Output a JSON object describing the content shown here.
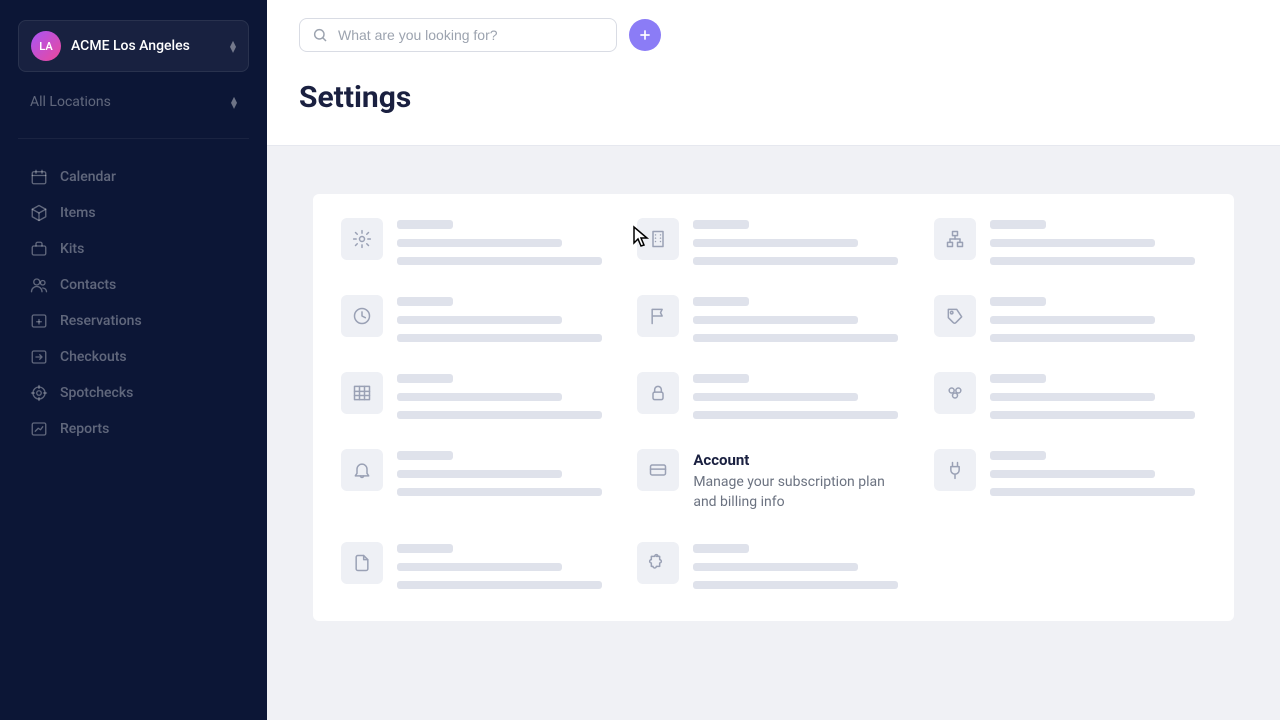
{
  "workspace": {
    "avatar": "LA",
    "name": "ACME Los Angeles"
  },
  "locations": {
    "label": "All Locations"
  },
  "nav": [
    {
      "label": "Calendar",
      "icon": "calendar"
    },
    {
      "label": "Items",
      "icon": "cube"
    },
    {
      "label": "Kits",
      "icon": "briefcase"
    },
    {
      "label": "Contacts",
      "icon": "users"
    },
    {
      "label": "Reservations",
      "icon": "reservation"
    },
    {
      "label": "Checkouts",
      "icon": "checkout"
    },
    {
      "label": "Spotchecks",
      "icon": "target"
    },
    {
      "label": "Reports",
      "icon": "chart"
    }
  ],
  "search": {
    "placeholder": "What are you looking for?"
  },
  "page": {
    "title": "Settings"
  },
  "tiles": [
    {
      "icon": "gear",
      "skeleton": true
    },
    {
      "icon": "building",
      "skeleton": true
    },
    {
      "icon": "sitemap",
      "skeleton": true
    },
    {
      "icon": "clock",
      "skeleton": true
    },
    {
      "icon": "flag",
      "skeleton": true
    },
    {
      "icon": "tag",
      "skeleton": true
    },
    {
      "icon": "table",
      "skeleton": true
    },
    {
      "icon": "lock",
      "skeleton": true
    },
    {
      "icon": "group",
      "skeleton": true
    },
    {
      "icon": "bell",
      "skeleton": true
    },
    {
      "icon": "card",
      "skeleton": false,
      "title": "Account",
      "desc": "Manage your subscription plan and billing info"
    },
    {
      "icon": "plug",
      "skeleton": true
    },
    {
      "icon": "file",
      "skeleton": true
    },
    {
      "icon": "puzzle",
      "skeleton": true
    }
  ]
}
